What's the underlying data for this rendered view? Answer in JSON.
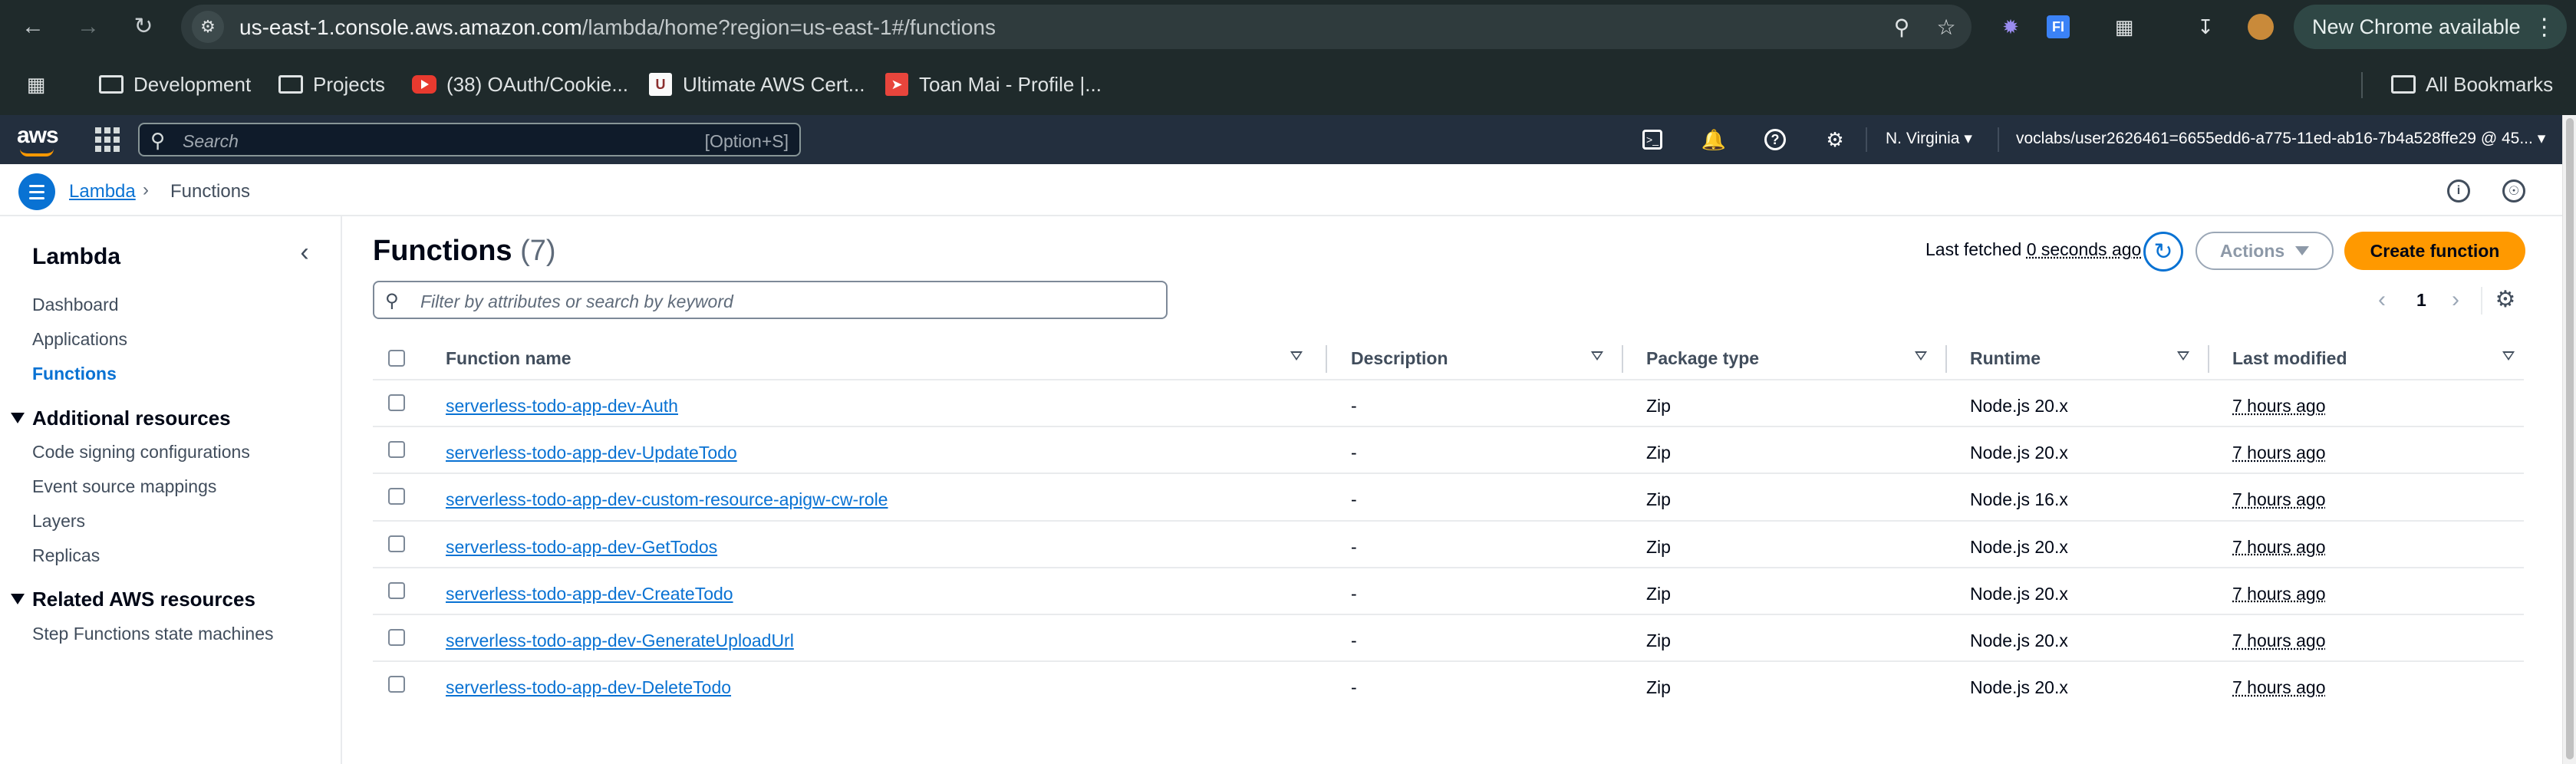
{
  "browser": {
    "url_host": "us-east-1.console.aws.amazon.com",
    "url_path": "/lambda/home?region=us-east-1#/functions",
    "new_chrome_label": "New Chrome available",
    "bookmarks": [
      {
        "label": "Development",
        "icon": "folder-icon"
      },
      {
        "label": "Projects",
        "icon": "folder-icon"
      },
      {
        "label": "(38) OAuth/Cookie...",
        "icon": "youtube-icon"
      },
      {
        "label": "Ultimate AWS Cert...",
        "icon": "udemy-icon"
      },
      {
        "label": "Toan Mai - Profile |...",
        "icon": "profile-favicon"
      }
    ],
    "all_bookmarks_label": "All Bookmarks"
  },
  "aws_nav": {
    "search_placeholder": "Search",
    "search_shortcut": "[Option+S]",
    "region": "N. Virginia",
    "account": "voclabs/user2626461=6655edd6-a775-11ed-ab16-7b4a528ffe29 @ 45..."
  },
  "breadcrumb": {
    "service": "Lambda",
    "current": "Functions"
  },
  "sidebar": {
    "title": "Lambda",
    "items": [
      {
        "label": "Dashboard"
      },
      {
        "label": "Applications"
      },
      {
        "label": "Functions",
        "active": true
      }
    ],
    "additional_resources": {
      "title": "Additional resources",
      "items": [
        {
          "label": "Code signing configurations"
        },
        {
          "label": "Event source mappings"
        },
        {
          "label": "Layers"
        },
        {
          "label": "Replicas"
        }
      ]
    },
    "related_resources": {
      "title": "Related AWS resources",
      "items": [
        {
          "label": "Step Functions state machines"
        }
      ]
    }
  },
  "main": {
    "title": "Functions",
    "count": "(7)",
    "last_fetched_prefix": "Last fetched ",
    "last_fetched_value": "0 seconds ago",
    "actions_label": "Actions",
    "create_label": "Create function",
    "filter_placeholder": "Filter by attributes or search by keyword",
    "page_number": "1",
    "columns": [
      "Function name",
      "Description",
      "Package type",
      "Runtime",
      "Last modified"
    ],
    "rows": [
      {
        "name": "serverless-todo-app-dev-Auth",
        "description": "-",
        "package": "Zip",
        "runtime": "Node.js 20.x",
        "modified": "7 hours ago"
      },
      {
        "name": "serverless-todo-app-dev-UpdateTodo",
        "description": "-",
        "package": "Zip",
        "runtime": "Node.js 20.x",
        "modified": "7 hours ago"
      },
      {
        "name": "serverless-todo-app-dev-custom-resource-apigw-cw-role",
        "description": "-",
        "package": "Zip",
        "runtime": "Node.js 16.x",
        "modified": "7 hours ago"
      },
      {
        "name": "serverless-todo-app-dev-GetTodos",
        "description": "-",
        "package": "Zip",
        "runtime": "Node.js 20.x",
        "modified": "7 hours ago"
      },
      {
        "name": "serverless-todo-app-dev-CreateTodo",
        "description": "-",
        "package": "Zip",
        "runtime": "Node.js 20.x",
        "modified": "7 hours ago"
      },
      {
        "name": "serverless-todo-app-dev-GenerateUploadUrl",
        "description": "-",
        "package": "Zip",
        "runtime": "Node.js 20.x",
        "modified": "7 hours ago"
      },
      {
        "name": "serverless-todo-app-dev-DeleteTodo",
        "description": "-",
        "package": "Zip",
        "runtime": "Node.js 20.x",
        "modified": "7 hours ago"
      }
    ]
  },
  "colors": {
    "aws_nav_bg": "#232f3e",
    "link_blue": "#0972d3",
    "primary_orange": "#ff9900",
    "chrome_bg": "#1f2a2b"
  }
}
